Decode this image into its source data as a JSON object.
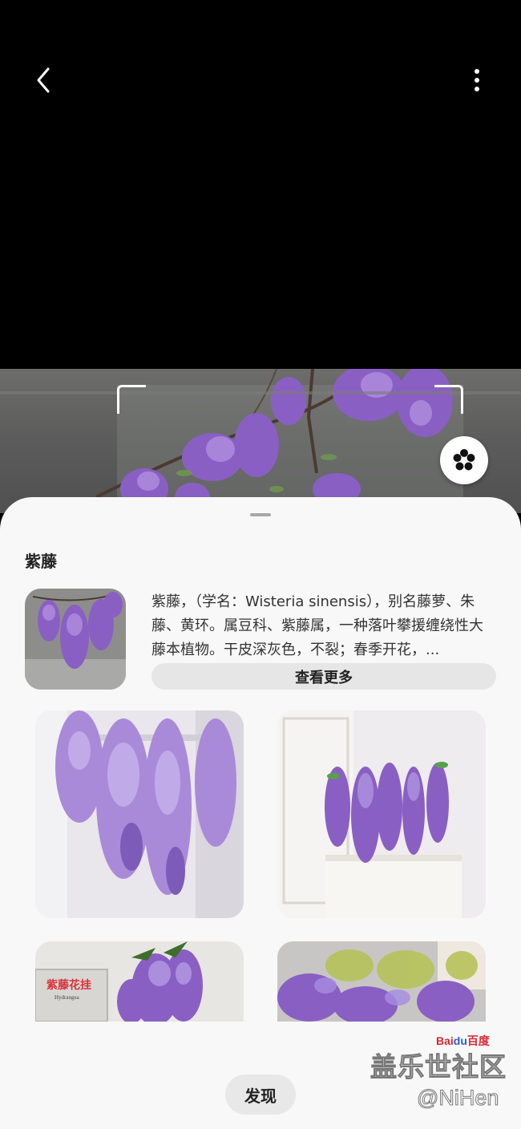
{
  "result": {
    "title": "紫藤",
    "description": "紫藤，（学名：Wisteria sinensis），别名藤萝、朱藤、黄环。属豆科、紫藤属，一种落叶攀援缠绕性大藤本植物。干皮深灰色，不裂；春季开花，...",
    "more_label": "查看更多"
  },
  "gallery": {
    "card3_sign_text": "紫藤花挂",
    "card3_sign_sub": "Hydrangea"
  },
  "discover_label": "发现",
  "watermark": {
    "baidu_red": "Bai",
    "baidu_blue": "du",
    "baidu_cn": "百度",
    "site": "盖乐世社区",
    "user": "@NiHen"
  },
  "icons": {
    "back": "chevron-left-icon",
    "more": "more-vertical-icon",
    "flower": "flower-icon"
  },
  "colors": {
    "sheet_bg": "#f8f8f8",
    "button_bg": "#e6e6e6",
    "flower_purple": "#8a5fc4"
  }
}
